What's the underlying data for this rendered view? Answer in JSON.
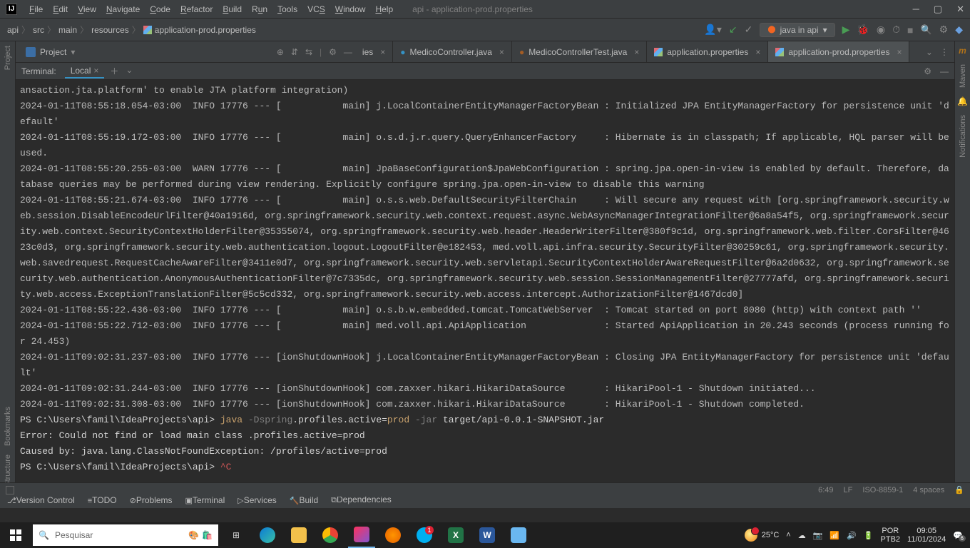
{
  "title": "api - application-prod.properties",
  "menu": [
    "File",
    "Edit",
    "View",
    "Navigate",
    "Code",
    "Refactor",
    "Build",
    "Run",
    "Tools",
    "VCS",
    "Window",
    "Help"
  ],
  "breadcrumbs": [
    "api",
    "src",
    "main",
    "resources",
    "application-prod.properties"
  ],
  "run_config": "java in api",
  "project_label": "Project",
  "tabs": [
    {
      "label": "ies",
      "icon": "none",
      "active": false,
      "truncated": true
    },
    {
      "label": "MedicoController.java",
      "icon": "java",
      "active": false
    },
    {
      "label": "MedicoControllerTest.java",
      "icon": "java-test",
      "active": false
    },
    {
      "label": "application.properties",
      "icon": "prop",
      "active": false
    },
    {
      "label": "application-prod.properties",
      "icon": "prop",
      "active": true
    }
  ],
  "terminal": {
    "label": "Terminal:",
    "session": "Local"
  },
  "left_rail": [
    "Project",
    "Bookmarks",
    "Structure"
  ],
  "right_rail": [
    "Maven",
    "Notifications"
  ],
  "bottom_tools": [
    {
      "label": "Version Control",
      "icon": "⎇"
    },
    {
      "label": "TODO",
      "icon": "≡"
    },
    {
      "label": "Problems",
      "icon": "⊘"
    },
    {
      "label": "Terminal",
      "icon": "▣",
      "active": true
    },
    {
      "label": "Services",
      "icon": "▷"
    },
    {
      "label": "Build",
      "icon": "🔨"
    },
    {
      "label": "Dependencies",
      "icon": "⧉"
    }
  ],
  "status": {
    "pos": "6:49",
    "eol": "LF",
    "encoding": "ISO-8859-1",
    "indent": "4 spaces"
  },
  "taskbar": {
    "search_placeholder": "Pesquisar",
    "temp": "25°C",
    "lang1": "POR",
    "lang2": "PTB2",
    "time": "09:05",
    "date": "11/01/2024"
  },
  "term_lines": [
    {
      "t": "ansaction.jta.platform' to enable JTA platform integration)"
    },
    {
      "t": "2024-01-11T08:55:18.054-03:00  INFO 17776 --- [           main] j.LocalContainerEntityManagerFactoryBean : Initialized JPA EntityManagerFactory for persistence unit 'default'"
    },
    {
      "t": "2024-01-11T08:55:19.172-03:00  INFO 17776 --- [           main] o.s.d.j.r.query.QueryEnhancerFactory     : Hibernate is in classpath; If applicable, HQL parser will be used."
    },
    {
      "t": "2024-01-11T08:55:20.255-03:00  WARN 17776 --- [           main] JpaBaseConfiguration$JpaWebConfiguration : spring.jpa.open-in-view is enabled by default. Therefore, database queries may be performed during view rendering. Explicitly configure spring.jpa.open-in-view to disable this warning"
    },
    {
      "t": "2024-01-11T08:55:21.674-03:00  INFO 17776 --- [           main] o.s.s.web.DefaultSecurityFilterChain     : Will secure any request with [org.springframework.security.web.session.DisableEncodeUrlFilter@40a1916d, org.springframework.security.web.context.request.async.WebAsyncManagerIntegrationFilter@6a8a54f5, org.springframework.security.web.context.SecurityContextHolderFilter@35355074, org.springframework.security.web.header.HeaderWriterFilter@380f9c1d, org.springframework.web.filter.CorsFilter@4623c0d3, org.springframework.security.web.authentication.logout.LogoutFilter@e182453, med.voll.api.infra.security.SecurityFilter@30259c61, org.springframework.security.web.savedrequest.RequestCacheAwareFilter@3411e0d7, org.springframework.security.web.servletapi.SecurityContextHolderAwareRequestFilter@6a2d0632, org.springframework.security.web.authentication.AnonymousAuthenticationFilter@7c7335dc, org.springframework.security.web.session.SessionManagementFilter@27777afd, org.springframework.security.web.access.ExceptionTranslationFilter@5c5cd332, org.springframework.security.web.access.intercept.AuthorizationFilter@1467dcd0]"
    },
    {
      "t": "2024-01-11T08:55:22.436-03:00  INFO 17776 --- [           main] o.s.b.w.embedded.tomcat.TomcatWebServer  : Tomcat started on port 8080 (http) with context path ''"
    },
    {
      "t": "2024-01-11T08:55:22.712-03:00  INFO 17776 --- [           main] med.voll.api.ApiApplication              : Started ApiApplication in 20.243 seconds (process running for 24.453)"
    },
    {
      "t": "2024-01-11T09:02:31.237-03:00  INFO 17776 --- [ionShutdownHook] j.LocalContainerEntityManagerFactoryBean : Closing JPA EntityManagerFactory for persistence unit 'default'"
    },
    {
      "t": "2024-01-11T09:02:31.244-03:00  INFO 17776 --- [ionShutdownHook] com.zaxxer.hikari.HikariDataSource       : HikariPool-1 - Shutdown initiated..."
    },
    {
      "t": "2024-01-11T09:02:31.308-03:00  INFO 17776 --- [ionShutdownHook] com.zaxxer.hikari.HikariDataSource       : HikariPool-1 - Shutdown completed."
    }
  ],
  "term_cmd": {
    "prompt1": "PS C:\\Users\\famil\\IdeaProjects\\api> ",
    "java": "java ",
    "dspring": "-Dspring",
    "profiles1": ".profiles.active=",
    "prod": "prod ",
    "jar_flag": "-jar ",
    "jar": "target/api-0.0.1-SNAPSHOT.jar",
    "err1": "Error: Could not find or load main class .profiles.active=prod",
    "err2": "Caused by: java.lang.ClassNotFoundException: /profiles/active=prod",
    "prompt2": "PS C:\\Users\\famil\\IdeaProjects\\api> ",
    "ctrlc": "^C"
  }
}
